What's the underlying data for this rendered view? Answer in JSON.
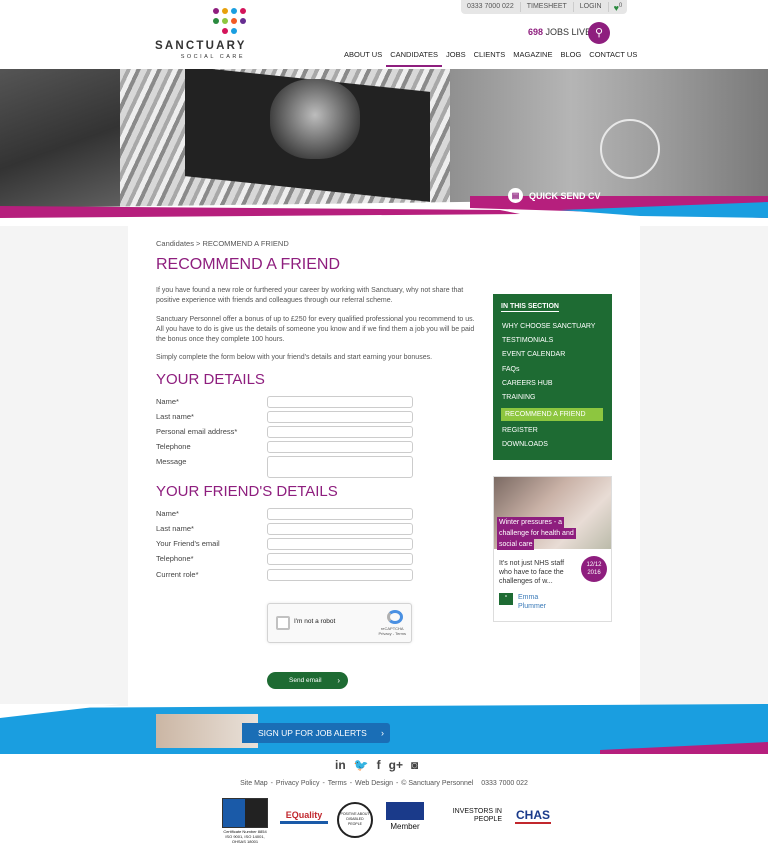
{
  "header": {
    "logo_main": "SANCTUARY",
    "logo_sub": "SOCIAL CARE",
    "phone": "0333 7000 022",
    "timesheet": "TIMESHEET",
    "login": "LOGIN",
    "fav_count": "0",
    "jobs_count": "698",
    "jobs_label": "JOBS LIVE",
    "nav": [
      "ABOUT US",
      "CANDIDATES",
      "JOBS",
      "CLIENTS",
      "MAGAZINE",
      "BLOG",
      "CONTACT US"
    ]
  },
  "hero": {
    "quick_send": "QUICK SEND CV"
  },
  "breadcrumb": "Candidates > RECOMMEND A FRIEND",
  "title": "RECOMMEND A FRIEND",
  "intro": [
    "If you have found a new role or furthered your career by working with Sanctuary, why not share that positive experience with friends and colleagues through our referral scheme.",
    "Sanctuary Personnel offer a bonus of up to £250 for every qualified professional you recommend to us. All you have to do is give us the details of someone you know and if we find them a job you will be paid the bonus once they complete 100 hours.",
    "Simply complete the form below with your friend's details and start earning your bonuses."
  ],
  "your_details": {
    "heading": "YOUR DETAILS",
    "fields": [
      "Name*",
      "Last name*",
      "Personal email address*",
      "Telephone",
      "Message"
    ]
  },
  "friend_details": {
    "heading": "YOUR FRIEND'S DETAILS",
    "fields": [
      "Name*",
      "Last name*",
      "Your Friend's email",
      "Telephone*",
      "Current role*"
    ]
  },
  "captcha": {
    "label": "I'm not a robot",
    "brand": "reCAPTCHA",
    "links": "Privacy - Terms"
  },
  "send_button": "Send email",
  "sidebar": {
    "heading": "IN THIS SECTION",
    "items": [
      "WHY CHOOSE SANCTUARY",
      "TESTIMONIALS",
      "EVENT CALENDAR",
      "FAQs",
      "CAREERS HUB",
      "TRAINING"
    ],
    "active": "RECOMMEND A FRIEND",
    "items_after": [
      "REGISTER",
      "DOWNLOADS"
    ]
  },
  "article": {
    "tag": [
      "Winter pressures - a",
      "challenge for health and",
      "social care"
    ],
    "excerpt": "It's not just NHS staff who have to face the challenges of w...",
    "date_line1": "12/12",
    "date_line2": "2016",
    "author": "Emma Plummer"
  },
  "alerts": "SIGN UP FOR JOB ALERTS",
  "social": [
    "in",
    "twitter",
    "f",
    "g+",
    "instagram"
  ],
  "footer_links": [
    "Site Map",
    "Privacy Policy",
    "Terms",
    "Web Design",
    "© Sanctuary Personnel",
    "0333 7000 022"
  ],
  "accreditations": {
    "iso_caption": "Certificate Number 8854\nISO 9001, ISO 14001,\nOHSAS 18001",
    "equality": "EQuality",
    "disability": "POSITIVE ABOUT DISABLED PEOPLE",
    "rec": "Member",
    "investors": "INVESTORS IN PEOPLE",
    "chas": "CHAS"
  },
  "colors": {
    "brand_purple": "#8e1e7e",
    "brand_green": "#1e6b33",
    "accent_lime": "#8dc63f",
    "accent_blue": "#1a9ee0"
  }
}
